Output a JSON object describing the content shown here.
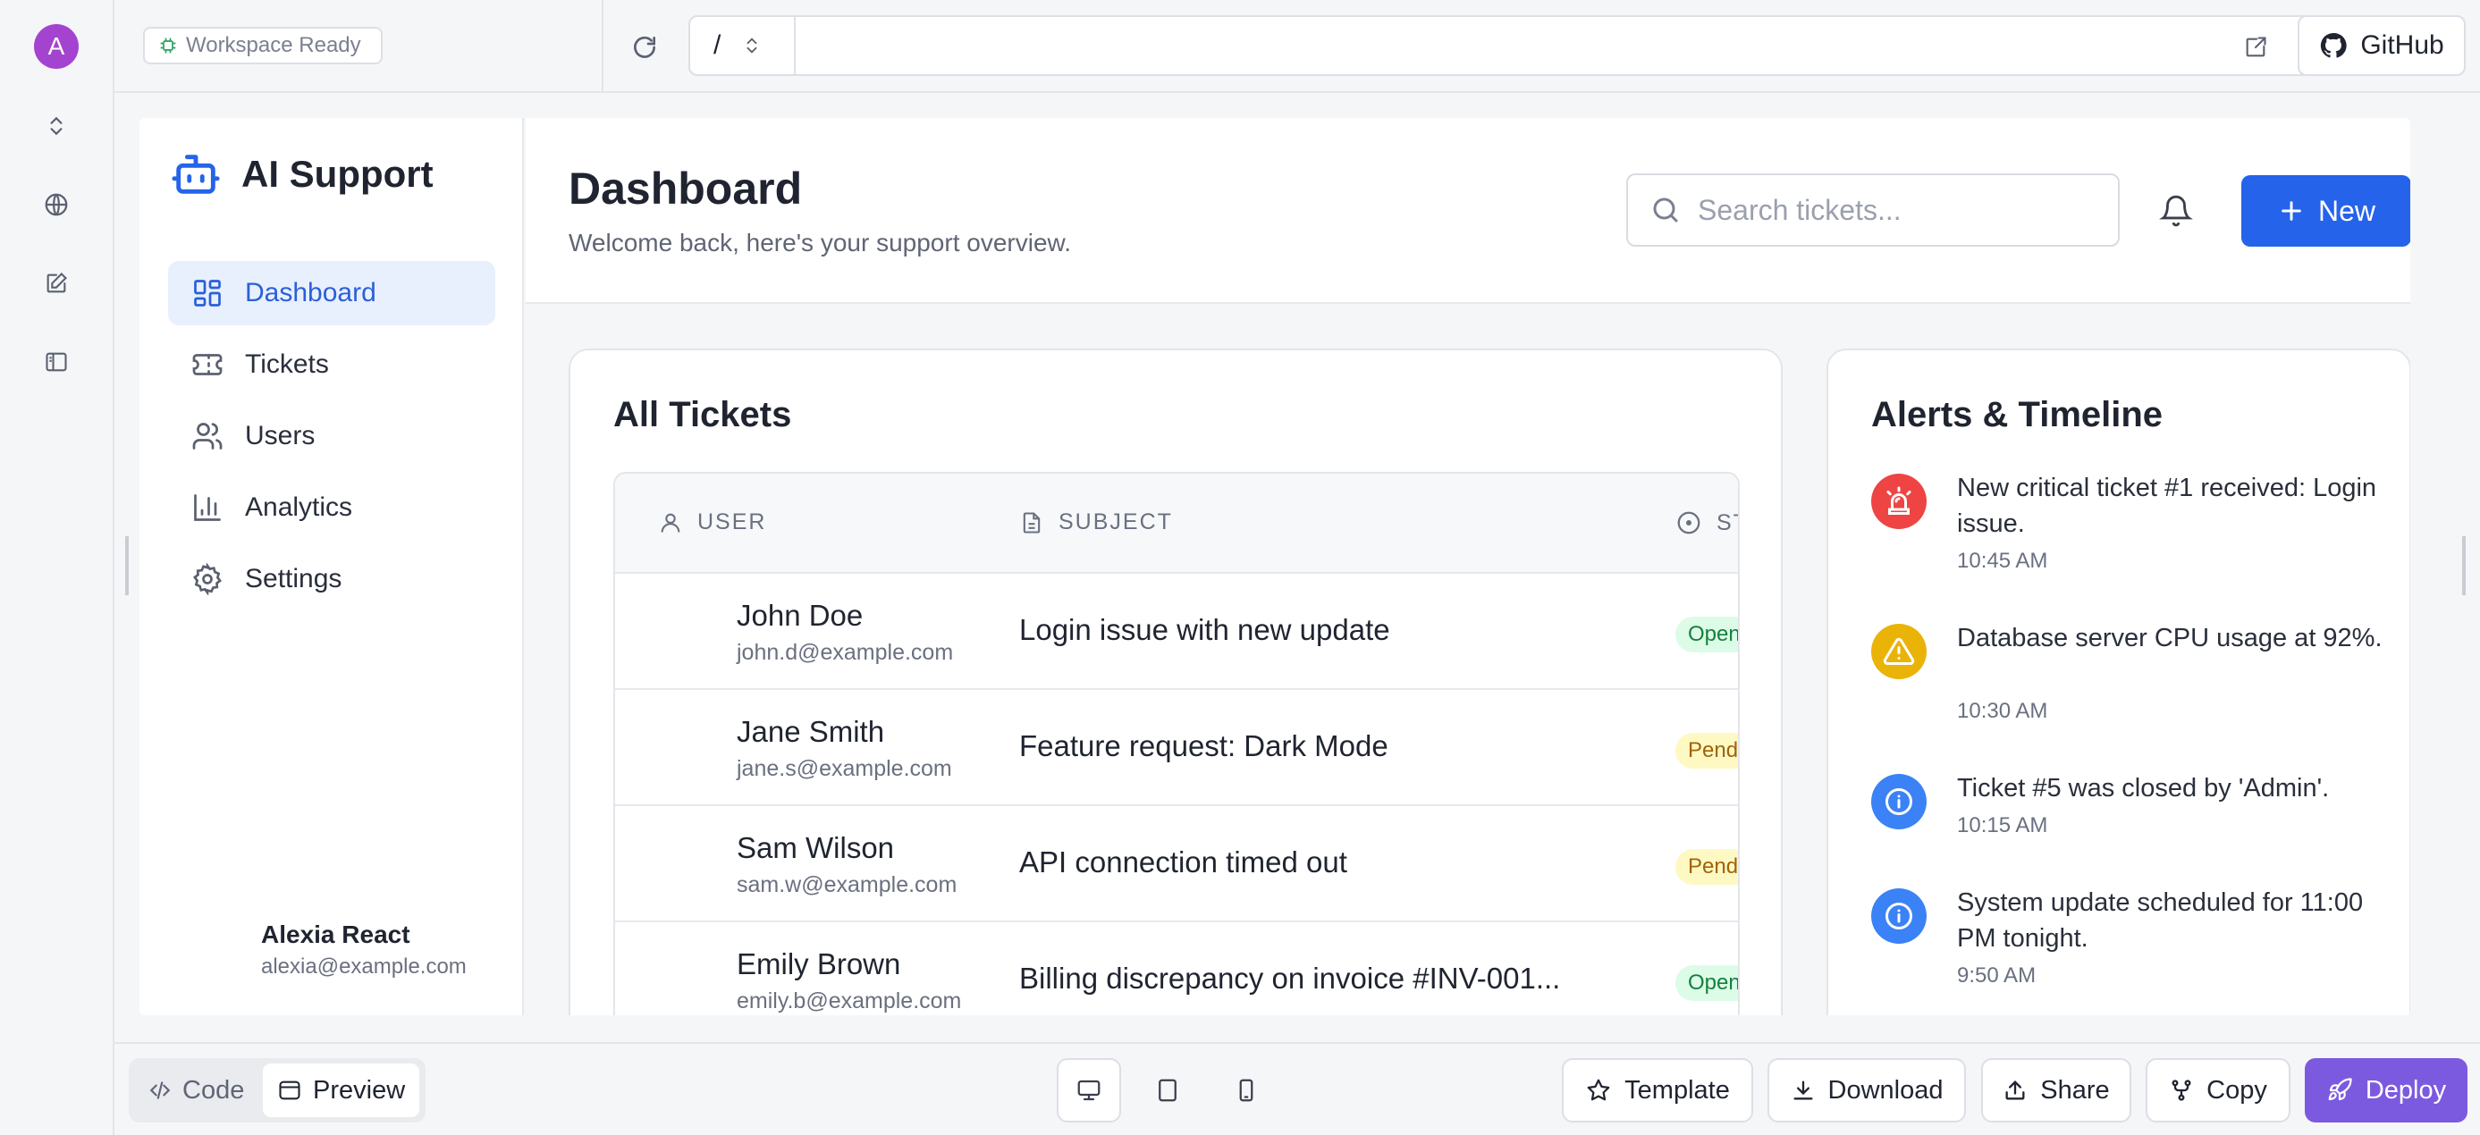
{
  "rail": {
    "avatar_letter": "A"
  },
  "topbar": {
    "workspace_status": "Workspace Ready",
    "url_path": "/",
    "url_value": "",
    "github_label": "GitHub"
  },
  "app": {
    "brand": "AI Support",
    "nav": [
      {
        "label": "Dashboard",
        "icon": "dashboard-icon",
        "active": true
      },
      {
        "label": "Tickets",
        "icon": "ticket-icon",
        "active": false
      },
      {
        "label": "Users",
        "icon": "users-icon",
        "active": false
      },
      {
        "label": "Analytics",
        "icon": "analytics-icon",
        "active": false
      },
      {
        "label": "Settings",
        "icon": "gear-icon",
        "active": false
      }
    ],
    "profile": {
      "name": "Alexia React",
      "email": "alexia@example.com"
    },
    "header": {
      "title": "Dashboard",
      "subtitle": "Welcome back, here's your support overview.",
      "search_placeholder": "Search tickets...",
      "new_label": "New"
    },
    "tickets": {
      "title": "All Tickets",
      "columns": [
        "USER",
        "SUBJECT",
        "STATUS"
      ],
      "rows": [
        {
          "name": "John Doe",
          "email": "john.d@example.com",
          "subject": "Login issue with new update",
          "status": "Open",
          "status_color": "#dcfce7",
          "status_text": "#15803d"
        },
        {
          "name": "Jane Smith",
          "email": "jane.s@example.com",
          "subject": "Feature request: Dark Mode",
          "status": "Pending",
          "status_color": "#fef9c3",
          "status_text": "#a16207"
        },
        {
          "name": "Sam Wilson",
          "email": "sam.w@example.com",
          "subject": "API connection timed out",
          "status": "Pending",
          "status_color": "#fef9c3",
          "status_text": "#a16207"
        },
        {
          "name": "Emily Brown",
          "email": "emily.b@example.com",
          "subject": "Billing discrepancy on invoice #INV-001...",
          "status": "Open",
          "status_color": "#dcfce7",
          "status_text": "#15803d"
        }
      ]
    },
    "alerts": {
      "title": "Alerts & Timeline",
      "items": [
        {
          "message": "New critical ticket #1 received: Login issue.",
          "time": "10:45 AM",
          "icon": "siren-icon",
          "color": "#ef4444"
        },
        {
          "message": "Database server CPU usage at 92%.",
          "time": "10:30 AM",
          "icon": "warning-icon",
          "color": "#eab308"
        },
        {
          "message": "Ticket #5 was closed by 'Admin'.",
          "time": "10:15 AM",
          "icon": "info-icon",
          "color": "#3b82f6"
        },
        {
          "message": "System update scheduled for 11:00 PM tonight.",
          "time": "9:50 AM",
          "icon": "info-icon",
          "color": "#3b82f6"
        }
      ]
    }
  },
  "bottombar": {
    "code_label": "Code",
    "preview_label": "Preview",
    "template_label": "Template",
    "download_label": "Download",
    "share_label": "Share",
    "copy_label": "Copy",
    "deploy_label": "Deploy"
  },
  "colors": {
    "accent": "#2563eb",
    "deploy": "#7c5ae0",
    "avatar": "#a443cf"
  }
}
